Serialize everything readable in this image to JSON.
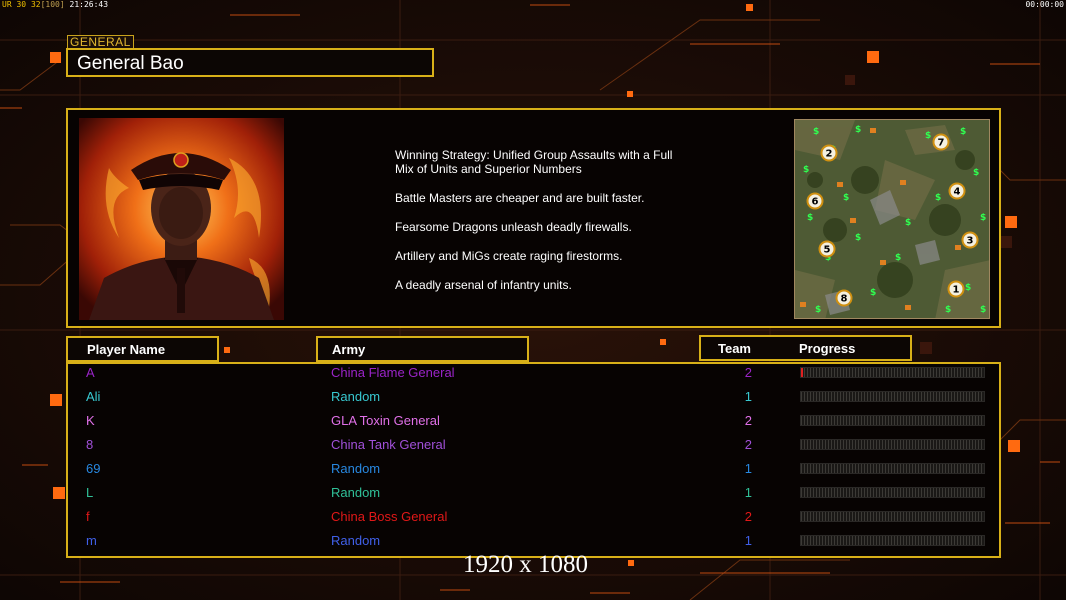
{
  "hud": {
    "left_prefix": "UR",
    "left_a": "30",
    "left_b": "32",
    "left_c": "[100]",
    "left_time": "21:26:43",
    "right_timer": "00:00:00"
  },
  "general": {
    "tag": "GENERAL",
    "name": "General Bao",
    "strategy": [
      "Winning Strategy: Unified Group Assaults with a Full\n Mix of Units and Superior Numbers",
      "Battle Masters are cheaper and are built faster.",
      "Fearsome Dragons unleash deadly firewalls.",
      "Artillery and MiGs create raging firestorms.",
      "A deadly arsenal of infantry units."
    ]
  },
  "map": {
    "start_positions": [
      "2",
      "7",
      "4",
      "6",
      "3",
      "5",
      "1",
      "8"
    ]
  },
  "headers": {
    "player_name": "Player Name",
    "army": "Army",
    "team": "Team",
    "progress": "Progress"
  },
  "players": [
    {
      "name": "A",
      "army": "China Flame General",
      "team": "2",
      "progress": 0.01,
      "color": "#9a24c8"
    },
    {
      "name": "Ali",
      "army": "Random",
      "team": "1",
      "progress": 0,
      "color": "#38c8d0"
    },
    {
      "name": "K",
      "army": "GLA Toxin General",
      "team": "2",
      "progress": 0,
      "color": "#e070e8"
    },
    {
      "name": "8",
      "army": "China Tank General",
      "team": "2",
      "progress": 0,
      "color": "#a050d8"
    },
    {
      "name": "69",
      "army": "Random",
      "team": "1",
      "progress": 0,
      "color": "#2888e0"
    },
    {
      "name": "L",
      "army": "Random",
      "team": "1",
      "progress": 0,
      "color": "#30c098"
    },
    {
      "name": "f",
      "army": "China Boss General",
      "team": "2",
      "progress": 0,
      "color": "#e01818"
    },
    {
      "name": "m",
      "army": "Random",
      "team": "1",
      "progress": 0,
      "color": "#4060e8"
    }
  ],
  "resolution_label": "1920 x 1080",
  "colors": {
    "frame": "#d8b018",
    "background": "#140a07"
  }
}
